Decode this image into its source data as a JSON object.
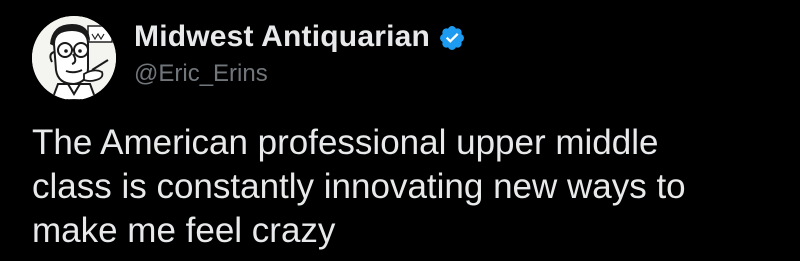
{
  "colors": {
    "background": "#000000",
    "primary_text": "#e7e9ea",
    "secondary_text": "#71767b",
    "verified_badge": "#1d9bf0"
  },
  "author": {
    "display_name": "Midwest Antiquarian",
    "handle": "@Eric_Erins",
    "verified": true,
    "badge_icon": "verified-badge-icon",
    "avatar_icon": "cartoon-man-avatar"
  },
  "tweet": {
    "text_lines": [
      "The American professional upper middle",
      "class is constantly innovating new ways to",
      "make me feel crazy"
    ]
  }
}
